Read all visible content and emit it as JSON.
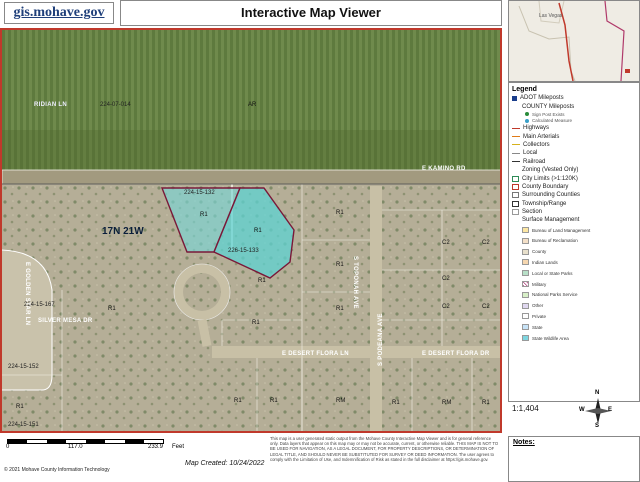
{
  "header": {
    "logo_text": "gis.mohave.gov",
    "title": "Interactive Map Viewer"
  },
  "overview": {
    "place_label": "Las Vegas"
  },
  "map": {
    "township": "17N 21W",
    "parcel_labels": [
      "224-07-014",
      "224-15-132",
      "226-15-133",
      "224-15-167",
      "224-15-152",
      "224-15-151"
    ],
    "zoning_labels": [
      "AR",
      "R1",
      "R1",
      "R1",
      "R1",
      "R1",
      "R1",
      "R1",
      "R1",
      "R1",
      "C2",
      "C2",
      "C2",
      "C2",
      "C2",
      "R1",
      "R1",
      "RM",
      "RM",
      "R1",
      "R1"
    ],
    "streets": [
      "E KAMINO RD",
      "E DESERT FLORA LN",
      "E DESERT FLORA DR",
      "S TOPONAH AVE",
      "S PODEANA AVE",
      "SILVER MESA DR",
      "E GOLDEN STAR LN",
      "RIDIAN LN"
    ]
  },
  "legend": {
    "title": "Legend",
    "items": [
      {
        "label": "ADOT Mileposts",
        "kind": "square",
        "color": "#1a3e8c"
      },
      {
        "label": "COUNTY Mileposts",
        "kind": "none",
        "color": "#ffffff"
      },
      {
        "label": "Sign Post Exists",
        "kind": "subdot",
        "color": "#2a8c3a"
      },
      {
        "label": "Calculated Measure",
        "kind": "subdot",
        "color": "#3aa0c8"
      },
      {
        "label": "Highways",
        "kind": "line",
        "color": "#c0392b"
      },
      {
        "label": "Main Arterials",
        "kind": "line",
        "color": "#e07b18"
      },
      {
        "label": "Collectors",
        "kind": "line",
        "color": "#d6b21c"
      },
      {
        "label": "Local",
        "kind": "line",
        "color": "#888888"
      },
      {
        "label": "Railroad",
        "kind": "line",
        "color": "#333333"
      },
      {
        "label": "Zoning (Vested Only)",
        "kind": "none",
        "color": "#ffffff"
      },
      {
        "label": "City Limits (>1:120K)",
        "kind": "box",
        "color": "#2e8b57"
      },
      {
        "label": "County Boundary",
        "kind": "box",
        "color": "#c0392b"
      },
      {
        "label": "Surrounding Counties",
        "kind": "box",
        "color": "#777777"
      },
      {
        "label": "Township/Range",
        "kind": "box",
        "color": "#333333"
      },
      {
        "label": "Section",
        "kind": "box",
        "color": "#999999"
      },
      {
        "label": "Surface Management",
        "kind": "none",
        "color": "#ffffff"
      }
    ],
    "surface_items": [
      {
        "label": "Bureau of Land Management",
        "color": "#fde7a3"
      },
      {
        "label": "Bureau of Reclamation",
        "color": "#f4e0c8"
      },
      {
        "label": "County",
        "color": "#e8e0cc"
      },
      {
        "label": "Indian Lands",
        "color": "#f6d7b0"
      },
      {
        "label": "Local or State Parks",
        "color": "#b8e0c8"
      },
      {
        "label": "Military",
        "color": "#f0c8e0"
      },
      {
        "label": "National Parks Service",
        "color": "#d8f0c8"
      },
      {
        "label": "Other",
        "color": "#e0d8f0"
      },
      {
        "label": "Private",
        "color": "#ffffff"
      },
      {
        "label": "State",
        "color": "#c8e4f8"
      },
      {
        "label": "State Wildlife Area",
        "color": "#7fd6e0"
      }
    ]
  },
  "scale_ratio": "1:1,404",
  "scalebar": {
    "ticks": [
      "0",
      "117.0",
      "233.9"
    ],
    "unit": "Feet"
  },
  "compass": {
    "n": "N",
    "s": "S",
    "e": "E",
    "w": "W"
  },
  "footer": {
    "created": "Map Created: 10/24/2022",
    "copyright": "© 2021 Mohave County Information Technology",
    "disclaimer": "This map is a user generated static output from the Mohave County Interactive Map Viewer and is for general reference only. Data layers that appear on this map may or may not be accurate, current, or otherwise reliable. THIS MAP IS NOT TO BE USED FOR NAVIGATION, AS A LEGAL DOCUMENT, FOR PROPERTY DESCRIPTIONS, OR DETERMINATION OF LEGAL TITLE, AND SHOULD NEVER BE SUBSTITUTED FOR SURVEY OR DEED INFORMATION. The user agrees to comply with the Limitation of Use, and Indemnification of Risk as stated in the full disclaimer at https://gis.mohave.gov."
  },
  "notes_label": "Notes:"
}
